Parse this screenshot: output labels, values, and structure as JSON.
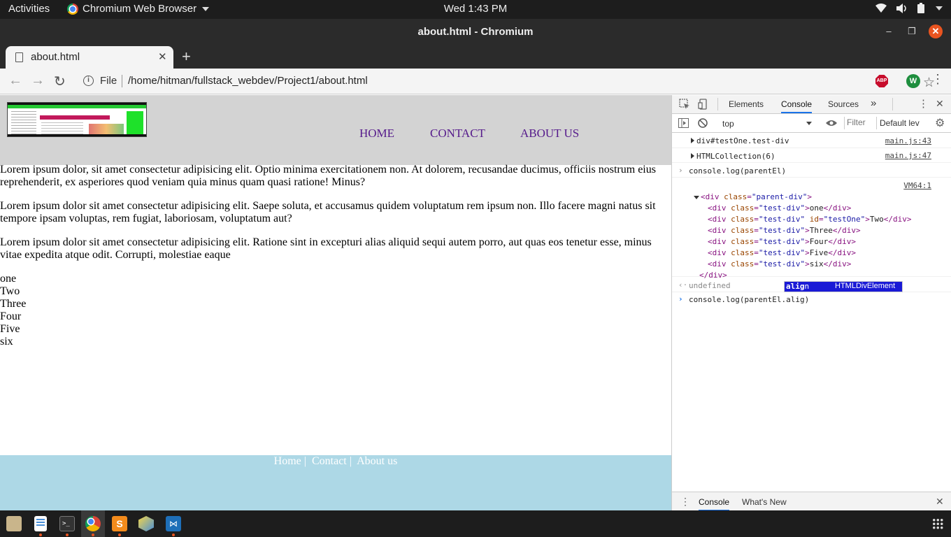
{
  "topbar": {
    "activities": "Activities",
    "app_name": "Chromium Web Browser",
    "clock": "Wed  1:43 PM"
  },
  "window": {
    "title": "about.html - Chromium"
  },
  "tab": {
    "title": "about.html",
    "close": "✕",
    "new_tab": "+"
  },
  "toolbar": {
    "back": "←",
    "forward": "→",
    "reload": "↻",
    "info": "i",
    "file_label": "File",
    "url": "/home/hitman/fullstack_webdev/Project1/about.html",
    "star": "☆",
    "abp": "ABP",
    "profile_initial": "W",
    "menu": "⋮"
  },
  "page": {
    "nav": [
      "HOME",
      "CONTACT",
      "ABOUT US"
    ],
    "paragraphs": [
      "Lorem ipsum dolor, sit amet consectetur adipisicing elit. Optio minima exercitationem non. At dolorem, recusandae ducimus, officiis nostrum eius reprehenderit, ex asperiores quod veniam quia minus quam quasi ratione! Minus?",
      "Lorem ipsum dolor sit amet consectetur adipisicing elit. Saepe soluta, et accusamus quidem voluptatum rem ipsum non. Illo facere magni natus sit tempore ipsam voluptas, rem fugiat, laboriosam, voluptatum aut?",
      "Lorem ipsum dolor sit amet consectetur adipisicing elit. Ratione sint in excepturi alias aliquid sequi autem porro, aut quas eos tenetur esse, minus vitae expedita atque odit. Corrupti, molestiae eaque"
    ],
    "divs": [
      "one",
      "Two",
      "Three",
      "Four",
      "Five",
      "six"
    ],
    "footer": {
      "home": "Home",
      "contact": "Contact",
      "about": "About us",
      "sep": "|"
    }
  },
  "devtools": {
    "tabs": [
      "Elements",
      "Console",
      "Sources"
    ],
    "more": "»",
    "context": "top",
    "filter_placeholder": "Filter",
    "levels": "Default lev",
    "logs": [
      {
        "text": "div#testOne.test-div",
        "src": "main.js:43"
      },
      {
        "text": "HTMLCollection(6)",
        "src": "main.js:47"
      }
    ],
    "input1": "console.log(parentEl)",
    "vm_src": "VM64:1",
    "parent_open": "<div class=\"parent-div\">",
    "parent_tag": "div",
    "parent_class": "parent-div",
    "children": [
      {
        "text": "one",
        "id": ""
      },
      {
        "text": "Two",
        "id": "testOne"
      },
      {
        "text": "Three",
        "id": ""
      },
      {
        "text": "Four",
        "id": ""
      },
      {
        "text": "Five",
        "id": ""
      },
      {
        "text": "six",
        "id": ""
      }
    ],
    "child_class": "test-div",
    "close_tag": "</div>",
    "result": "undefined",
    "autocomplete_match": "alig",
    "autocomplete_rest": "n",
    "autocomplete_type": "HTMLDivElement",
    "current_input": "console.log(parentEl.alig)",
    "drawer_tabs": [
      "Console",
      "What's New"
    ],
    "close": "✕"
  },
  "colors": {
    "accent": "#1a73e8",
    "ubuntu_orange": "#e95420",
    "header_gray": "#d3d3d3",
    "footer_blue": "#add8e6",
    "link_purple": "#551a8b"
  }
}
